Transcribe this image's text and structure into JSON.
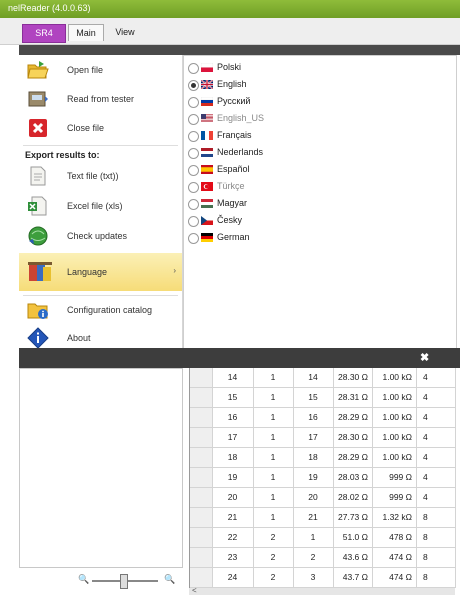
{
  "app": {
    "title": "nelReader (4.0.0.63)"
  },
  "tabs": {
    "sr4": "SR4",
    "main": "Main",
    "view": "View"
  },
  "menu": {
    "open_file": "Open file",
    "read_from_tester": "Read from tester",
    "close_file": "Close file",
    "export_header": "Export results to:",
    "text_file": "Text file (txt))",
    "excel_file": "Excel file (xls)",
    "check_updates": "Check updates",
    "language": "Language",
    "configuration_catalog": "Configuration catalog",
    "about": "About",
    "submenu_arrow": "›"
  },
  "languages": [
    {
      "label": "Polski",
      "selected": false,
      "faded": false
    },
    {
      "label": "English",
      "selected": true,
      "faded": false
    },
    {
      "label": "Русский",
      "selected": false,
      "faded": false
    },
    {
      "label": "English_US",
      "selected": false,
      "faded": true
    },
    {
      "label": "Français",
      "selected": false,
      "faded": false
    },
    {
      "label": "Nederlands",
      "selected": false,
      "faded": false
    },
    {
      "label": "Español",
      "selected": false,
      "faded": false
    },
    {
      "label": "Türkçe",
      "selected": false,
      "faded": true
    },
    {
      "label": "Magyar",
      "selected": false,
      "faded": false
    },
    {
      "label": "Česky",
      "selected": false,
      "faded": false
    },
    {
      "label": "German",
      "selected": false,
      "faded": false
    }
  ],
  "close_symbol": "✖",
  "zoom": {
    "minus": "🔍",
    "plus": "🔍"
  },
  "scroll_left": "<",
  "table": {
    "rows": [
      [
        "14",
        "1",
        "14",
        "28.30 Ω",
        "1.00 kΩ",
        "4"
      ],
      [
        "15",
        "1",
        "15",
        "28.31 Ω",
        "1.00 kΩ",
        "4"
      ],
      [
        "16",
        "1",
        "16",
        "28.29 Ω",
        "1.00 kΩ",
        "4"
      ],
      [
        "17",
        "1",
        "17",
        "28.30 Ω",
        "1.00 kΩ",
        "4"
      ],
      [
        "18",
        "1",
        "18",
        "28.29 Ω",
        "1.00 kΩ",
        "4"
      ],
      [
        "19",
        "1",
        "19",
        "28.03 Ω",
        "999 Ω",
        "4"
      ],
      [
        "20",
        "1",
        "20",
        "28.02 Ω",
        "999 Ω",
        "4"
      ],
      [
        "21",
        "1",
        "21",
        "27.73 Ω",
        "1.32 kΩ",
        "8"
      ],
      [
        "22",
        "2",
        "1",
        "51.0 Ω",
        "478 Ω",
        "8"
      ],
      [
        "23",
        "2",
        "2",
        "43.6 Ω",
        "474 Ω",
        "8"
      ],
      [
        "24",
        "2",
        "3",
        "43.7 Ω",
        "474 Ω",
        "8"
      ]
    ]
  },
  "colors": {
    "accent": "#b044c0",
    "titlebar": "#7aa82d",
    "highlight": "#f6dc78"
  }
}
